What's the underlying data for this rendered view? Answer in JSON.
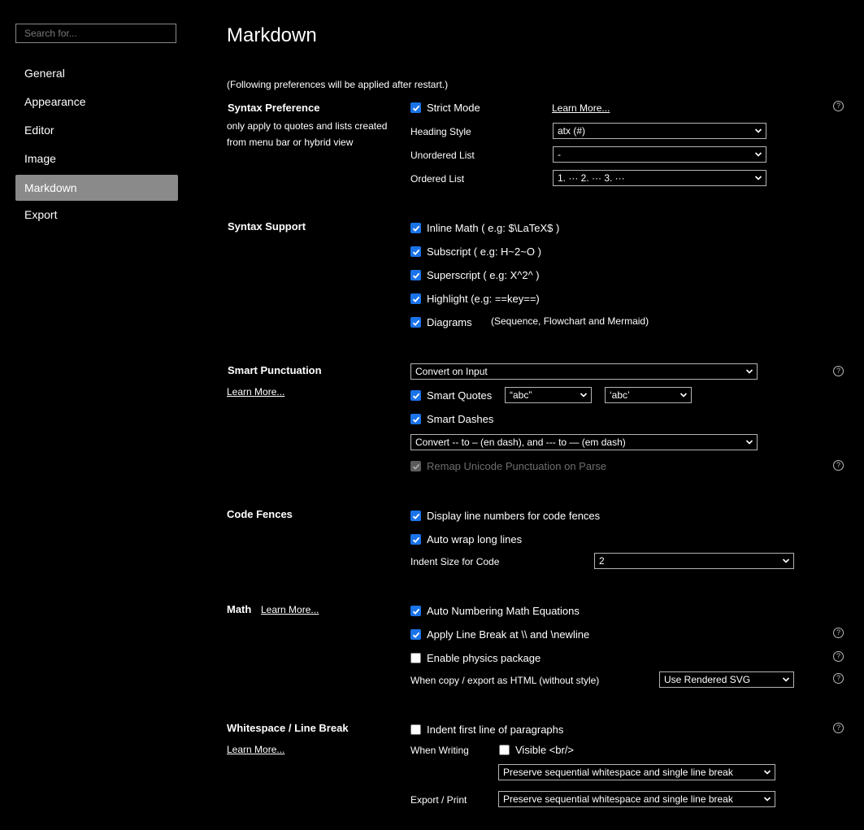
{
  "sidebar": {
    "search_placeholder": "Search for...",
    "items": [
      {
        "label": "General"
      },
      {
        "label": "Appearance"
      },
      {
        "label": "Editor"
      },
      {
        "label": "Image"
      },
      {
        "label": "Markdown",
        "active": true
      },
      {
        "label": "Export"
      }
    ]
  },
  "main": {
    "title": "Markdown",
    "restart_note": "(Following preferences will be applied after restart.)",
    "syntax_preference": {
      "title": "Syntax Preference",
      "description": "only apply to quotes and lists created from menu bar or hybrid view",
      "strict_mode": {
        "label": "Strict Mode",
        "checked": true
      },
      "learn_more": "Learn More...",
      "heading_style": {
        "label": "Heading Style",
        "value": "atx (#)"
      },
      "unordered_list": {
        "label": "Unordered List",
        "value": "-"
      },
      "ordered_list": {
        "label": "Ordered List",
        "value": "1. ··· 2. ··· 3. ···"
      }
    },
    "syntax_support": {
      "title": "Syntax Support",
      "inline_math": {
        "label": "Inline Math ( e.g: $\\LaTeX$ )",
        "checked": true
      },
      "subscript": {
        "label": "Subscript ( e.g: H~2~O )",
        "checked": true
      },
      "superscript": {
        "label": "Superscript ( e.g: X^2^ )",
        "checked": true
      },
      "highlight": {
        "label": "Highlight (e.g: ==key==)",
        "checked": true
      },
      "diagrams": {
        "label": "Diagrams",
        "checked": true,
        "note": "(Sequence, Flowchart and Mermaid)"
      }
    },
    "smart_punctuation": {
      "title": "Smart Punctuation",
      "learn_more": "Learn More...",
      "mode": "Convert on Input",
      "smart_quotes": {
        "label": "Smart Quotes",
        "checked": true,
        "double_value": "“abc”",
        "single_value": "‘abc’"
      },
      "smart_dashes": {
        "label": "Smart Dashes",
        "checked": true
      },
      "dash_mode": "Convert -- to – (en dash), and --- to — (em dash)",
      "remap_unicode": {
        "label": "Remap Unicode Punctuation on Parse",
        "checked": true,
        "disabled": true
      }
    },
    "code_fences": {
      "title": "Code Fences",
      "line_numbers": {
        "label": "Display line numbers for code fences",
        "checked": true
      },
      "auto_wrap": {
        "label": "Auto wrap long lines",
        "checked": true
      },
      "indent_size": {
        "label": "Indent Size for Code",
        "value": "2"
      }
    },
    "math": {
      "title": "Math",
      "learn_more": "Learn More...",
      "auto_numbering": {
        "label": "Auto Numbering Math Equations",
        "checked": true
      },
      "line_break": {
        "label": "Apply Line Break at \\\\ and \\newline",
        "checked": true
      },
      "physics": {
        "label": "Enable physics package",
        "checked": false
      },
      "copy_export": {
        "label": "When copy / export as HTML (without style)",
        "value": "Use Rendered SVG"
      }
    },
    "whitespace": {
      "title": "Whitespace / Line Break",
      "learn_more": "Learn More...",
      "indent_first": {
        "label": "Indent first line of paragraphs",
        "checked": false
      },
      "when_writing": {
        "label": "When Writing",
        "visible_br": {
          "label": "Visible <br/>",
          "checked": false
        },
        "value": "Preserve sequential whitespace and single line break"
      },
      "export_print": {
        "label": "Export / Print",
        "value": "Preserve sequential whitespace and single line break"
      }
    },
    "help_glyph": "?"
  },
  "colors": {
    "background": "#000000",
    "checkbox_accent": "#1a73e8",
    "active_nav": "#8a8a8a"
  }
}
